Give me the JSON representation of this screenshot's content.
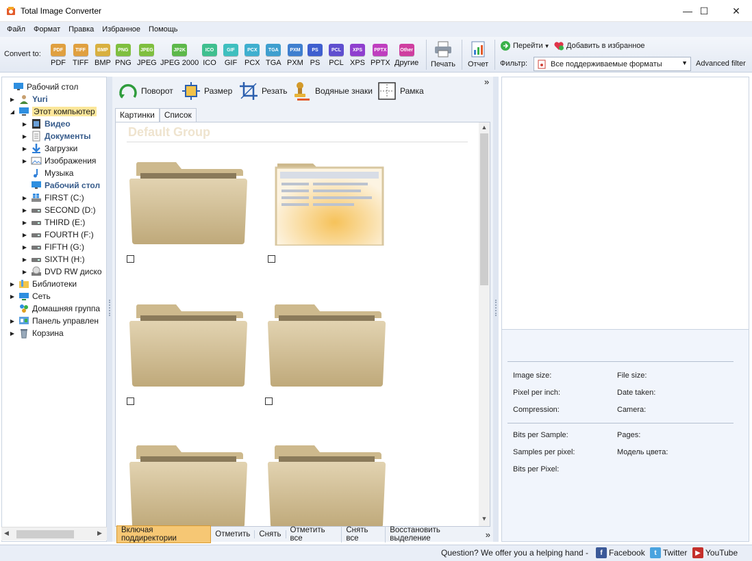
{
  "window": {
    "title": "Total Image Converter",
    "minimize": "—",
    "maximize": "☐",
    "close": "✕"
  },
  "menu": [
    "Файл",
    "Формат",
    "Правка",
    "Избранное",
    "Помощь"
  ],
  "toolbar": {
    "convert_to": "Convert to:",
    "formats": [
      {
        "badge": "PDF",
        "label": "PDF",
        "color": "#e0a040"
      },
      {
        "badge": "TIFF",
        "label": "TIFF",
        "color": "#e0a040"
      },
      {
        "badge": "BMP",
        "label": "BMP",
        "color": "#d8b040"
      },
      {
        "badge": "PNG",
        "label": "PNG",
        "color": "#7fbf3f"
      },
      {
        "badge": "JPEG",
        "label": "JPEG",
        "color": "#7fbf3f"
      },
      {
        "badge": "JP2K",
        "label": "JPEG 2000",
        "color": "#5db84a"
      },
      {
        "badge": "ICO",
        "label": "ICO",
        "color": "#3fbf8f"
      },
      {
        "badge": "GIF",
        "label": "GIF",
        "color": "#3fbfbf"
      },
      {
        "badge": "PCX",
        "label": "PCX",
        "color": "#3fafcf"
      },
      {
        "badge": "TGA",
        "label": "TGA",
        "color": "#3f9fcf"
      },
      {
        "badge": "PXM",
        "label": "PXM",
        "color": "#3f7fcf"
      },
      {
        "badge": "PS",
        "label": "PS",
        "color": "#3f5fcf"
      },
      {
        "badge": "PCL",
        "label": "PCL",
        "color": "#5f4fcf"
      },
      {
        "badge": "XPS",
        "label": "XPS",
        "color": "#8f3fcf"
      },
      {
        "badge": "PPTX",
        "label": "PPTX",
        "color": "#bf3fbf"
      },
      {
        "badge": "Other",
        "label": "Другие",
        "color": "#cf3fa0"
      }
    ],
    "print": "Печать",
    "report": "Отчет",
    "goto": "Перейти",
    "add_favorite": "Добавить в избранное",
    "filter_label": "Фильтр:",
    "filter_value": "Все поддерживаемые форматы",
    "advanced_filter": "Advanced filter"
  },
  "tree": [
    {
      "label": "Рабочий стол",
      "level": 0,
      "arrow": "",
      "icon": "desktop-icon",
      "bold": false,
      "selected": false
    },
    {
      "label": "Yuri",
      "level": 1,
      "arrow": "▶",
      "icon": "user-icon",
      "bold": true,
      "selected": false
    },
    {
      "label": "Этот компьютер",
      "level": 1,
      "arrow": "◢",
      "icon": "computer-icon",
      "bold": false,
      "selected": true
    },
    {
      "label": "Видео",
      "level": 2,
      "arrow": "▶",
      "icon": "video-icon",
      "bold": true,
      "selected": false
    },
    {
      "label": "Документы",
      "level": 2,
      "arrow": "▶",
      "icon": "documents-icon",
      "bold": true,
      "selected": false
    },
    {
      "label": "Загрузки",
      "level": 2,
      "arrow": "▶",
      "icon": "download-icon",
      "bold": false,
      "selected": false
    },
    {
      "label": "Изображения",
      "level": 2,
      "arrow": "▶",
      "icon": "pictures-icon",
      "bold": false,
      "selected": false
    },
    {
      "label": "Музыка",
      "level": 2,
      "arrow": "",
      "icon": "music-icon",
      "bold": false,
      "selected": false
    },
    {
      "label": "Рабочий стол",
      "level": 2,
      "arrow": "",
      "icon": "desktop-icon",
      "bold": true,
      "selected": false
    },
    {
      "label": "FIRST (C:)",
      "level": 2,
      "arrow": "▶",
      "icon": "windows-drive-icon",
      "bold": false,
      "selected": false
    },
    {
      "label": "SECOND (D:)",
      "level": 2,
      "arrow": "▶",
      "icon": "drive-icon",
      "bold": false,
      "selected": false
    },
    {
      "label": "THIRD (E:)",
      "level": 2,
      "arrow": "▶",
      "icon": "drive-icon",
      "bold": false,
      "selected": false
    },
    {
      "label": "FOURTH (F:)",
      "level": 2,
      "arrow": "▶",
      "icon": "drive-icon",
      "bold": false,
      "selected": false
    },
    {
      "label": "FIFTH (G:)",
      "level": 2,
      "arrow": "▶",
      "icon": "drive-icon",
      "bold": false,
      "selected": false
    },
    {
      "label": "SIXTH (H:)",
      "level": 2,
      "arrow": "▶",
      "icon": "drive-icon",
      "bold": false,
      "selected": false
    },
    {
      "label": "DVD RW диско",
      "level": 2,
      "arrow": "▶",
      "icon": "dvd-icon",
      "bold": false,
      "selected": false
    },
    {
      "label": "Библиотеки",
      "level": 1,
      "arrow": "▶",
      "icon": "libraries-icon",
      "bold": false,
      "selected": false
    },
    {
      "label": "Сеть",
      "level": 1,
      "arrow": "▶",
      "icon": "network-icon",
      "bold": false,
      "selected": false
    },
    {
      "label": "Домашняя группа",
      "level": 1,
      "arrow": "",
      "icon": "homegroup-icon",
      "bold": false,
      "selected": false
    },
    {
      "label": "Панель управлен",
      "level": 1,
      "arrow": "▶",
      "icon": "control-panel-icon",
      "bold": false,
      "selected": false
    },
    {
      "label": "Корзина",
      "level": 1,
      "arrow": "▶",
      "icon": "recycle-bin-icon",
      "bold": false,
      "selected": false
    }
  ],
  "actions": {
    "rotate": "Поворот",
    "resize": "Размер",
    "crop": "Резать",
    "watermark": "Водяные знаки",
    "frame": "Рамка",
    "more": "»"
  },
  "tabs": [
    "Картинки",
    "Список"
  ],
  "gallery": {
    "group_title": "Default Group"
  },
  "bottom": {
    "include_subdirs": "Включая поддиректории",
    "check": "Отметить",
    "uncheck": "Снять",
    "check_all": "Отметить все",
    "uncheck_all": "Снять все",
    "restore_selection": "Восстановить выделение",
    "more": "»"
  },
  "info": {
    "image_size": "Image size:",
    "file_size": "File size:",
    "ppi": "Pixel per inch:",
    "date_taken": "Date taken:",
    "compression": "Compression:",
    "camera": "Camera:",
    "bits_sample": "Bits per Sample:",
    "pages": "Pages:",
    "samples_pixel": "Samples per pixel:",
    "color_model": "Модель цвета:",
    "bits_pixel": "Bits per Pixel:"
  },
  "status": {
    "help": "Question? We offer you a helping hand -",
    "facebook": "Facebook",
    "twitter": "Twitter",
    "youtube": "YouTube"
  }
}
